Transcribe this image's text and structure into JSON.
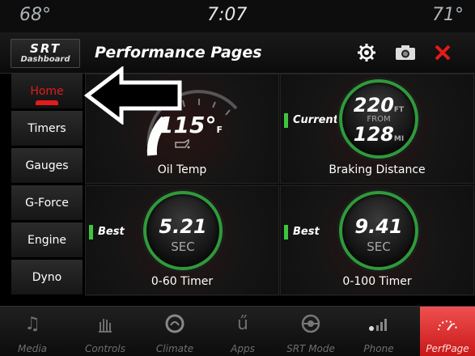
{
  "status": {
    "temp_left": "68°",
    "time": "7:07",
    "temp_right": "71°"
  },
  "header": {
    "logo_top": "SRT",
    "logo_bottom": "Dashboard",
    "title": "Performance Pages"
  },
  "sidebar": {
    "items": [
      {
        "label": "Home"
      },
      {
        "label": "Timers"
      },
      {
        "label": "Gauges"
      },
      {
        "label": "G-Force"
      },
      {
        "label": "Engine"
      },
      {
        "label": "Dyno"
      }
    ],
    "active": "Home"
  },
  "tiles": {
    "oil": {
      "value": "115°",
      "unit": "F",
      "label": "Oil Temp"
    },
    "braking": {
      "tag": "Current",
      "value_ft": "220",
      "unit_ft": "FT",
      "from": "FROM",
      "value_mi": "128",
      "unit_mi": "MI",
      "label": "Braking Distance"
    },
    "t060": {
      "tag": "Best",
      "value": "5.21",
      "unit": "SEC",
      "label": "0-60 Timer"
    },
    "t0100": {
      "tag": "Best",
      "value": "9.41",
      "unit": "SEC",
      "label": "0-100 Timer"
    }
  },
  "navbar": {
    "items": [
      {
        "label": "Media",
        "icon": "music-note-icon"
      },
      {
        "label": "Controls",
        "icon": "controls-hand-icon"
      },
      {
        "label": "Climate",
        "icon": "climate-icon"
      },
      {
        "label": "Apps",
        "icon": "apps-icon"
      },
      {
        "label": "SRT Mode",
        "icon": "steering-wheel-icon"
      },
      {
        "label": "Phone",
        "icon": "phone-signal-icon"
      },
      {
        "label": "PerfPage",
        "icon": "performance-gauge-icon"
      }
    ],
    "active": "PerfPage"
  },
  "colors": {
    "accent_red": "#e31b1b",
    "accent_green": "#3ec63e"
  }
}
